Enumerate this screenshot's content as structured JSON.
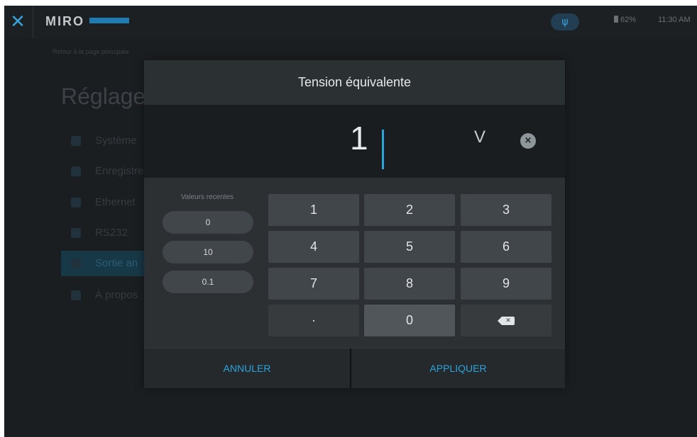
{
  "topbar": {
    "logo": "MIRO",
    "battery": "62%",
    "clock": "11:30 AM"
  },
  "background": {
    "breadcrumb": "Retour à la page principale",
    "title": "Réglages",
    "menu": [
      "Système",
      "Enregistre",
      "Ethernet",
      "RS232",
      "Sortie an",
      "À propos"
    ]
  },
  "dialog": {
    "title": "Tension équivalente",
    "value": "1",
    "unit": "V",
    "clear_glyph": "×",
    "recent_label": "Valeurs recentes",
    "recent_values": [
      "0",
      "10",
      "0.1"
    ],
    "keys": [
      "1",
      "2",
      "3",
      "4",
      "5",
      "6",
      "7",
      "8",
      "9",
      "·",
      "0"
    ],
    "cancel": "ANNULER",
    "apply": "APPLIQUER"
  },
  "colors": {
    "accent": "#2aa5dc",
    "screen_bg": "#1b1e20",
    "dialog_bg": "#2c3033",
    "key_bg": "#41464a"
  }
}
